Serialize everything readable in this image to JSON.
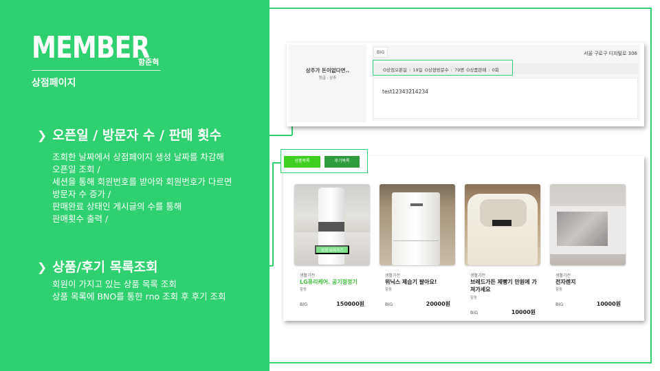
{
  "header": {
    "title": "MEMBER",
    "author": "함준혁",
    "subtitle": "상점페이지"
  },
  "sections": [
    {
      "heading": "오픈일 / 방문자 수 / 판매 횟수",
      "lines": [
        "조회한 날짜에서 상점페이지 생성 날짜를 차감해",
        "오픈일 조회 /",
        "세션을 통해 회원번호를 받아와 회원번호가 다르면",
        "방문자 수 증가 /",
        "판매완료 상태인 게시글의 수를 통해",
        "판매횟수 출력 /"
      ]
    },
    {
      "heading": "상품/후기 목록조회",
      "lines": [
        "회원이 가지고 있는 상품 목록 조회",
        "상품 목록에 BNO를 통한 rno 조회 후 후기 조회"
      ]
    }
  ],
  "shop": {
    "name": "상추가 돈이없다면..",
    "grade": "등급 : 상추",
    "big_tag": "BiG",
    "address": "서울 구로구 디지털로 306",
    "stats": "O상점오픈일 : 19일   O상점방문수 : 79명   O상품판매 : 0회",
    "intro": "test12343214234"
  },
  "tabs": {
    "products": "상품목록",
    "reviews": "후기목록"
  },
  "view_button": "상점 보러가기",
  "products": [
    {
      "category": "생활가전",
      "name": "LG퓨리케어. 공기청정기",
      "location": "항동",
      "badge": "BiG",
      "price": "150000원"
    },
    {
      "category": "생활가전",
      "name": "위닉스 제습기 팔아요!",
      "location": "항동",
      "badge": "BiG",
      "price": "20000원"
    },
    {
      "category": "생활가전",
      "name": "브레드가든 제빵기 만원에 가져가세요",
      "location": "항동",
      "badge": "BiG",
      "price": "10000원"
    },
    {
      "category": "생활가전",
      "name": "전자렌지",
      "location": "항동",
      "badge": "BiG",
      "price": "10000원"
    }
  ],
  "colors": {
    "accent": "#2fd06f",
    "tab_products": "#3fcf20",
    "tab_reviews": "#2f9c3d"
  }
}
